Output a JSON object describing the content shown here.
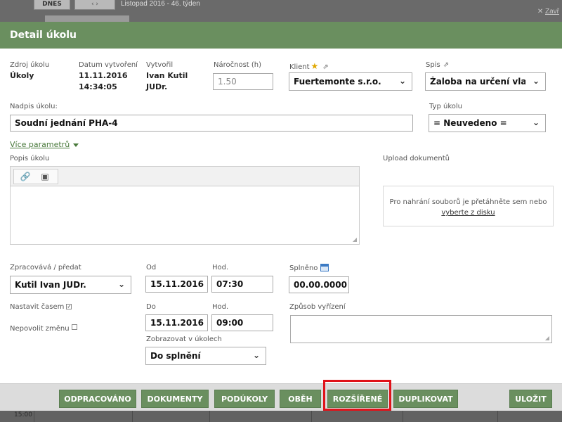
{
  "background": {
    "today_label": "DNES",
    "nav_arrows": "‹  ›",
    "period_label": "Listopad 2016 - 46. týden",
    "close_label": "Zavř",
    "time_label": "15:00"
  },
  "modal": {
    "title": "Detail úkolu"
  },
  "meta": {
    "zdroj_label": "Zdroj úkolu",
    "zdroj_value": "Úkoly",
    "datum_label": "Datum vytvoření",
    "datum_value_date": "11.11.2016",
    "datum_value_time": "14:34:05",
    "vytvoril_label": "Vytvořil",
    "vytvoril_value_1": "Ivan Kutil",
    "vytvoril_value_2": "JUDr.",
    "narocnost_label": "Náročnost (h)",
    "narocnost_value": "1.50",
    "klient_label": "Klient",
    "klient_value": "Fuertemonte s.r.o.",
    "spis_label": "Spis",
    "spis_value": "Žaloba na určení vlastnictv"
  },
  "task": {
    "nadpis_label": "Nadpis úkolu:",
    "nadpis_value": "Soudní jednání PHA-4",
    "typ_label": "Typ úkolu",
    "typ_value": "= Neuvedeno =",
    "more_params": "Více parametrů",
    "popis_label": "Popis úkolu",
    "upload_label": "Upload dokumentů",
    "upload_text": "Pro nahrání souborů je přetáhněte sem nebo",
    "upload_link": "vyberte z disku"
  },
  "schedule": {
    "zpracovava_label": "Zpracovává / předat",
    "zpracovava_value": "Kutil Ivan JUDr.",
    "od_label": "Od",
    "od_date": "15.11.2016",
    "hod_label_1": "Hod.",
    "od_time": "07:30",
    "splneno_label": "Splněno",
    "splneno_value": "00.00.0000",
    "nastavit_label": "Nastavit časem",
    "nastavit_checked": "✓",
    "nepovolit_label": "Nepovolit změnu",
    "do_label": "Do",
    "do_date": "15.11.2016",
    "hod_label_2": "Hod.",
    "do_time": "09:00",
    "zpusob_label": "Způsob vyřízení",
    "zobrazovat_label": "Zobrazovat v úkolech",
    "zobrazovat_value": "Do splnění"
  },
  "footer": {
    "buttons": [
      "ODPRACOVÁNO",
      "DOKUMENTY",
      "PODÚKOLY",
      "OBĚH",
      "ROZŠÍŘENÉ",
      "DUPLIKOVAT",
      "ULOŽIT"
    ]
  },
  "icons": {
    "star": "★",
    "external": "⇗",
    "chevron": "⌄",
    "link": "🔗",
    "unlink": "▣",
    "resize": "◢"
  },
  "colors": {
    "header_green": "#6a8f5f",
    "button_green": "#6a8f5f",
    "highlight_red": "#e0131a"
  }
}
